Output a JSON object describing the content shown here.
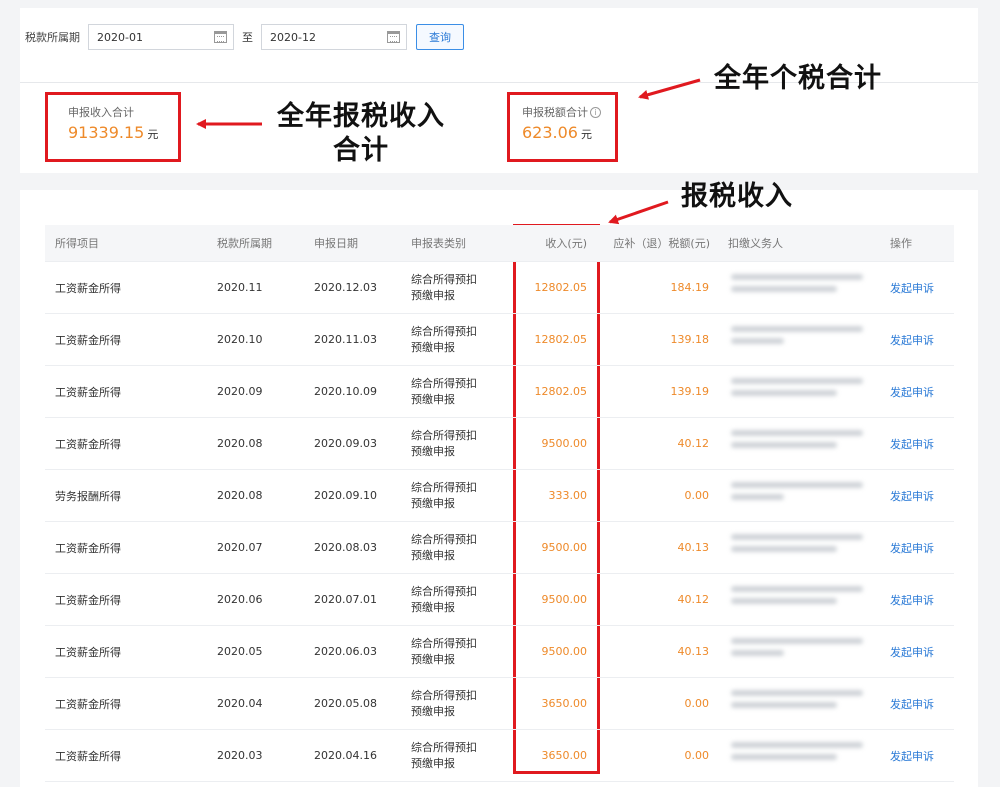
{
  "filter": {
    "label": "税款所属期",
    "start": "2020-01",
    "separator": "至",
    "end": "2020-12",
    "query_button": "查询"
  },
  "summary": {
    "income_label": "申报收入合计",
    "income_value": "91339.15",
    "income_unit": "元",
    "tax_label": "申报税额合计",
    "tax_value": "623.06",
    "tax_unit": "元",
    "info_glyph": "i"
  },
  "annotations": {
    "annual_income_line1": "全年报税收入",
    "annual_income_line2": "合计",
    "annual_tax": "全年个税合计",
    "reported_income": "报税收入"
  },
  "table": {
    "headers": {
      "item": "所得项目",
      "period": "税款所属期",
      "date": "申报日期",
      "type": "申报表类别",
      "income": "收入(元)",
      "tax": "应补（退）税额(元)",
      "withholder": "扣缴义务人",
      "action": "操作"
    },
    "rows": [
      {
        "item": "工资薪金所得",
        "period": "2020.11",
        "date": "2020.12.03",
        "type1": "综合所得预扣",
        "type2": "预缴申报",
        "income": "12802.05",
        "tax": "184.19",
        "action": "发起申诉"
      },
      {
        "item": "工资薪金所得",
        "period": "2020.10",
        "date": "2020.11.03",
        "type1": "综合所得预扣",
        "type2": "预缴申报",
        "income": "12802.05",
        "tax": "139.18",
        "action": "发起申诉"
      },
      {
        "item": "工资薪金所得",
        "period": "2020.09",
        "date": "2020.10.09",
        "type1": "综合所得预扣",
        "type2": "预缴申报",
        "income": "12802.05",
        "tax": "139.19",
        "action": "发起申诉"
      },
      {
        "item": "工资薪金所得",
        "period": "2020.08",
        "date": "2020.09.03",
        "type1": "综合所得预扣",
        "type2": "预缴申报",
        "income": "9500.00",
        "tax": "40.12",
        "action": "发起申诉"
      },
      {
        "item": "劳务报酬所得",
        "period": "2020.08",
        "date": "2020.09.10",
        "type1": "综合所得预扣",
        "type2": "预缴申报",
        "income": "333.00",
        "tax": "0.00",
        "action": "发起申诉"
      },
      {
        "item": "工资薪金所得",
        "period": "2020.07",
        "date": "2020.08.03",
        "type1": "综合所得预扣",
        "type2": "预缴申报",
        "income": "9500.00",
        "tax": "40.13",
        "action": "发起申诉"
      },
      {
        "item": "工资薪金所得",
        "period": "2020.06",
        "date": "2020.07.01",
        "type1": "综合所得预扣",
        "type2": "预缴申报",
        "income": "9500.00",
        "tax": "40.12",
        "action": "发起申诉"
      },
      {
        "item": "工资薪金所得",
        "period": "2020.05",
        "date": "2020.06.03",
        "type1": "综合所得预扣",
        "type2": "预缴申报",
        "income": "9500.00",
        "tax": "40.13",
        "action": "发起申诉"
      },
      {
        "item": "工资薪金所得",
        "period": "2020.04",
        "date": "2020.05.08",
        "type1": "综合所得预扣",
        "type2": "预缴申报",
        "income": "3650.00",
        "tax": "0.00",
        "action": "发起申诉"
      },
      {
        "item": "工资薪金所得",
        "period": "2020.03",
        "date": "2020.04.16",
        "type1": "综合所得预扣",
        "type2": "预缴申报",
        "income": "3650.00",
        "tax": "0.00",
        "action": "发起申诉"
      }
    ]
  },
  "colors": {
    "accent_orange": "#ee8a2a",
    "link_blue": "#2b7ad6",
    "annotation_red": "#e0191f"
  }
}
